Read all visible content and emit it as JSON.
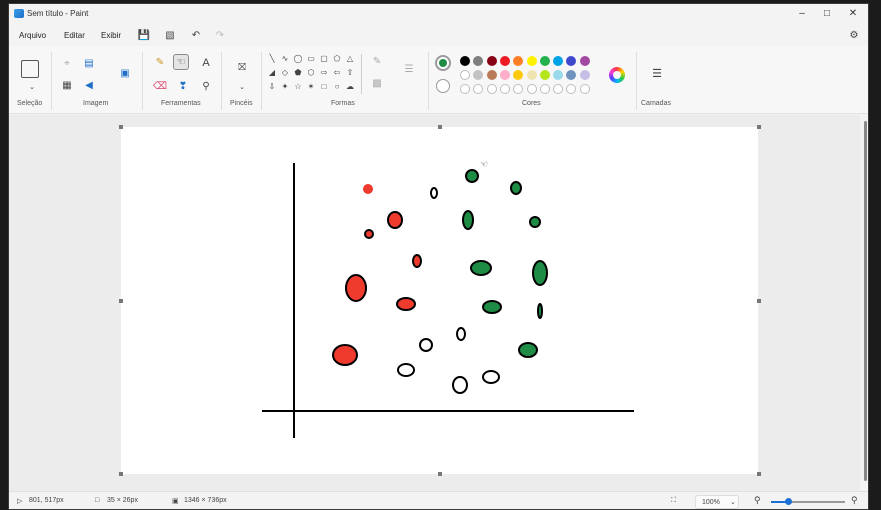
{
  "window": {
    "title": "Sem título - Paint",
    "minimize_icon": "minimize-icon",
    "maximize_icon": "maximize-icon",
    "close_icon": "close-icon"
  },
  "menu": {
    "items": [
      "Arquivo",
      "Editar",
      "Exibir"
    ],
    "quick_actions": [
      "save-icon",
      "open-icon",
      "undo-icon",
      "redo-icon"
    ],
    "settings_icon": "gear-icon"
  },
  "ribbon": {
    "groups": {
      "selection": "Seleção",
      "image": "Imagem",
      "tools": "Ferramentas",
      "brushes": "Pincéis",
      "shapes": "Formas",
      "colors": "Cores",
      "layers": "Camadas"
    },
    "tools_text_glyph": "A",
    "selected_tool": "fill-icon",
    "primary_color": "#1e8c45",
    "secondary_color": "#ffffff",
    "swatch_row_1": [
      "#000000",
      "#7f7f7f",
      "#880015",
      "#ed1c24",
      "#ff7f27",
      "#fff200",
      "#22b14c",
      "#00a2e8",
      "#3f48cc",
      "#a349a4"
    ],
    "swatch_row_2": [
      "#ffffff",
      "#c3c3c3",
      "#b97a57",
      "#ffaec9",
      "#ffc90e",
      "#efe4b0",
      "#b5e61d",
      "#99d9ea",
      "#7092be",
      "#c8bfe7"
    ]
  },
  "status": {
    "cursor_position": "801, 517px",
    "selection_size": "35 × 26px",
    "canvas_size": "1346 × 736px",
    "zoom": "100%"
  },
  "drawing_colors": {
    "red": "#ef3b2d",
    "green": "#1e8c45",
    "white": "#ffffff",
    "stroke": "#000000"
  }
}
